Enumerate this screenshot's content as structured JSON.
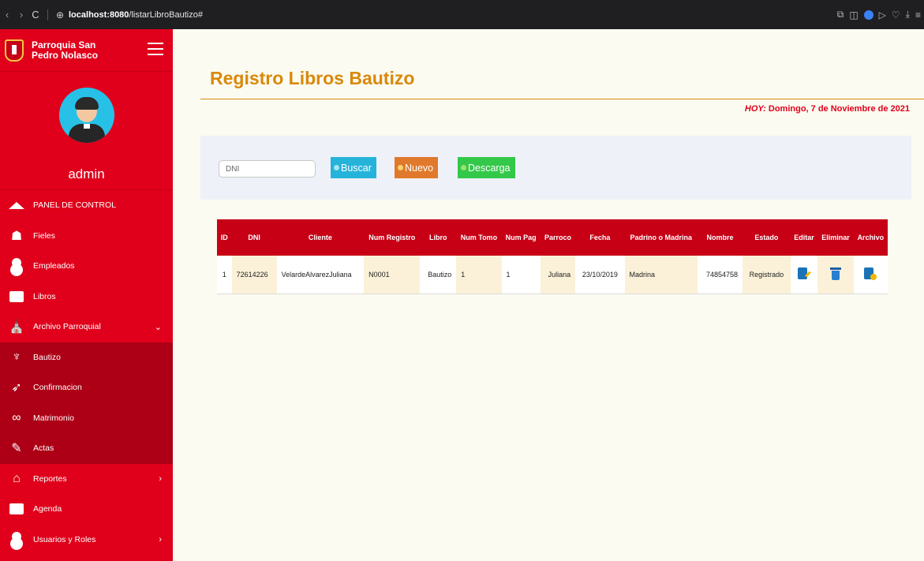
{
  "browser": {
    "back": "‹",
    "forward": "›",
    "reload": "C",
    "site_icon": "⊕",
    "url_host": "localhost:8080",
    "url_path": "/listarLibroBautizo#"
  },
  "sidebar": {
    "brand_name": "Parroquia San Pedro Nolasco",
    "username": "admin",
    "items": [
      {
        "label": "PANEL DE CONTROL",
        "icon": "house-icon"
      },
      {
        "label": "Fieles",
        "icon": "people-icon"
      },
      {
        "label": "Empleados",
        "icon": "employee-icon"
      },
      {
        "label": "Libros",
        "icon": "books-icon"
      },
      {
        "label": "Archivo Parroquial",
        "icon": "church-icon",
        "arrow": "⌄"
      },
      {
        "label": "Bautizo",
        "icon": "baptism-icon"
      },
      {
        "label": "Confirmacion",
        "icon": "dove-icon"
      },
      {
        "label": "Matrimonio",
        "icon": "rings-icon"
      },
      {
        "label": "Actas",
        "icon": "document-icon"
      },
      {
        "label": "Reportes",
        "icon": "report-icon",
        "arrow": "›"
      },
      {
        "label": "Agenda",
        "icon": "agenda-icon"
      },
      {
        "label": "Usuarios y Roles",
        "icon": "user-icon",
        "arrow": "›"
      }
    ]
  },
  "main": {
    "title": "Registro Libros Bautizo",
    "today_prefix": "HOY:",
    "today_value": " Domingo, 7 de Noviembre de 2021",
    "search": {
      "placeholder": "DNI",
      "buscar_label": "Buscar",
      "nuevo_label": "Nuevo",
      "descarga_label": "Descarga"
    }
  },
  "table": {
    "headers": [
      "ID",
      "DNI",
      "Cliente",
      "Num Registro",
      "Libro",
      "Num Tomo",
      "Num Pag",
      "Parroco",
      "Fecha",
      "Padrino o Madrina",
      "Nombre",
      "Estado",
      "Editar",
      "Eliminar",
      "Archivo"
    ],
    "rows": [
      {
        "id": "1",
        "dni": "72614226",
        "cliente": "VelardeAlvarezJuliana",
        "num_registro": "N0001",
        "libro": "Bautizo",
        "num_tomo": "1",
        "num_pag": "1",
        "parroco": "Juliana",
        "fecha": "23/10/2019",
        "padrino": "Madrina",
        "nombre": "74854758",
        "estado": "Registrado"
      }
    ]
  },
  "colors": {
    "sidebar": "#e0001b",
    "sidebar_sub": "#ad0016",
    "title": "#d9890a",
    "today": "#e0001b",
    "buscar": "#26b3da",
    "nuevo": "#e0792b",
    "descarga": "#34c84a",
    "table_header": "#c70016"
  }
}
